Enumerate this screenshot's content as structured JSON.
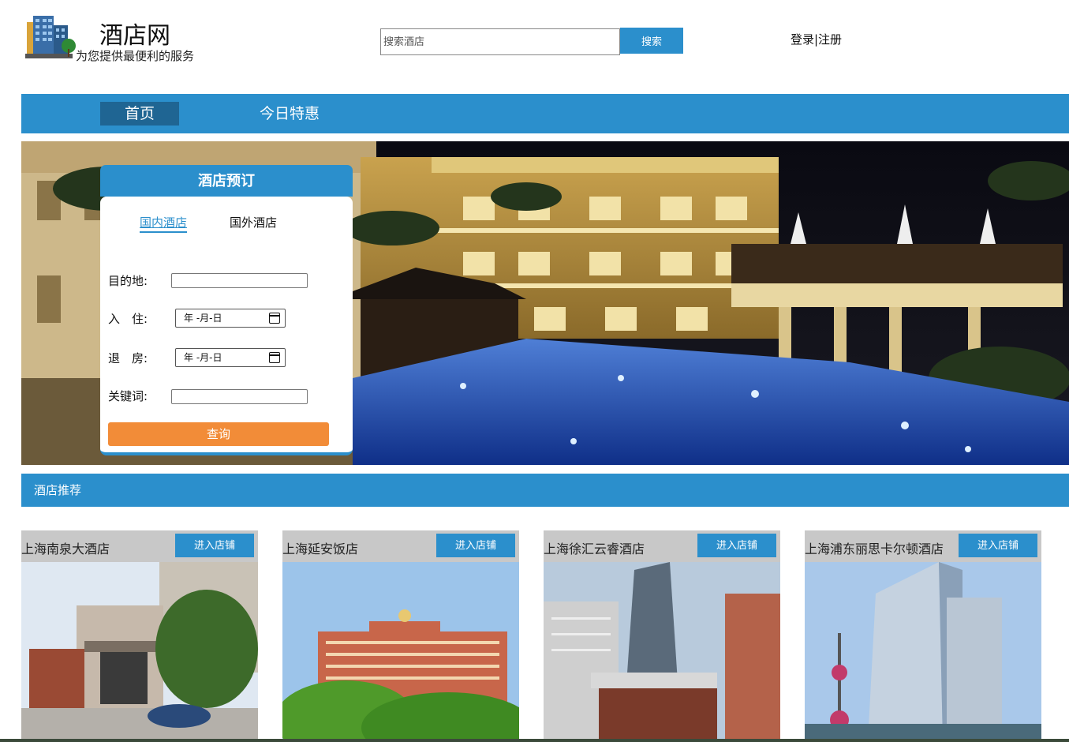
{
  "header": {
    "site_title": "酒店网",
    "slogan": "为您提供最便利的服务",
    "search_placeholder": "搜索酒店",
    "search_button": "搜索",
    "login_register": "登录|注册"
  },
  "nav": {
    "items": [
      {
        "label": "首页",
        "active": true
      },
      {
        "label": "今日特惠",
        "active": false
      }
    ]
  },
  "booking": {
    "title": "酒店预订",
    "tabs": [
      {
        "label": "国内酒店",
        "active": true
      },
      {
        "label": "国外酒店",
        "active": false
      }
    ],
    "fields": {
      "destination_label": "目的地:",
      "checkin_label": "入　住:",
      "checkin_value": "年 -月-日",
      "checkout_label": "退　房:",
      "checkout_value": "年 -月-日",
      "keyword_label": "关键词:"
    },
    "query_button": "查询"
  },
  "recommend": {
    "title": "酒店推荐",
    "button_label": "进入店铺",
    "hotels": [
      {
        "name": "上海南泉大酒店"
      },
      {
        "name": "上海延安饭店"
      },
      {
        "name": "上海徐汇云睿酒店"
      },
      {
        "name": "上海浦东丽思卡尔顿酒店"
      }
    ]
  },
  "colors": {
    "accent": "#2b8fcc",
    "nav_active": "#1f6593",
    "query_button": "#f28c38",
    "card_header": "#c8c8c8"
  }
}
